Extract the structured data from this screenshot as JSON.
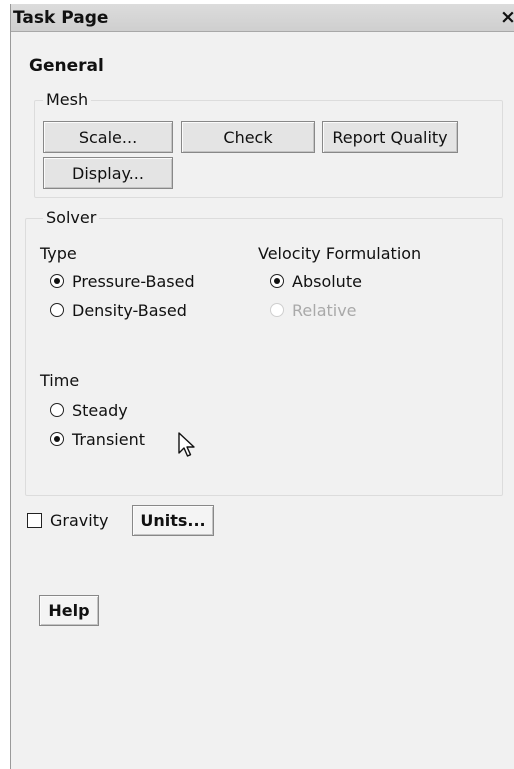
{
  "window": {
    "title": "Task Page",
    "close_glyph": "×"
  },
  "section_title": "General",
  "mesh": {
    "label": "Mesh",
    "buttons": {
      "scale": "Scale...",
      "check": "Check",
      "report_quality": "Report Quality",
      "display": "Display..."
    }
  },
  "solver": {
    "label": "Solver",
    "type": {
      "label": "Type",
      "options": [
        "Pressure-Based",
        "Density-Based"
      ],
      "selected": "Pressure-Based"
    },
    "velocity_formulation": {
      "label": "Velocity Formulation",
      "options": [
        "Absolute",
        "Relative"
      ],
      "selected": "Absolute",
      "disabled": [
        "Relative"
      ]
    },
    "time": {
      "label": "Time",
      "options": [
        "Steady",
        "Transient"
      ],
      "selected": "Transient"
    }
  },
  "gravity": {
    "label": "Gravity",
    "checked": false
  },
  "buttons": {
    "units": "Units...",
    "help": "Help"
  },
  "icons": {
    "close": "close-icon",
    "cursor": "mouse-pointer-icon"
  }
}
